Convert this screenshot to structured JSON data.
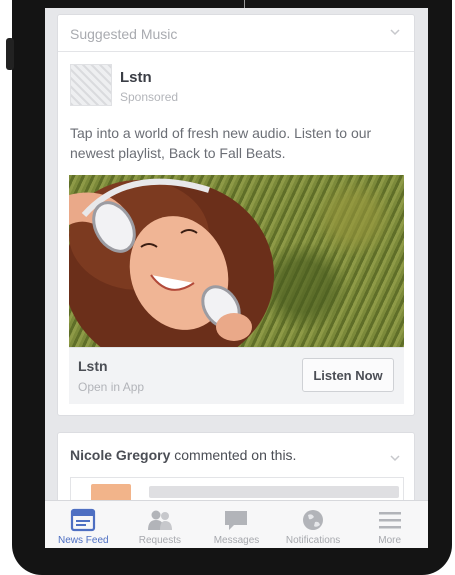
{
  "ad": {
    "header_label": "Suggested Music",
    "page_name": "Lstn",
    "sponsored_label": "Sponsored",
    "post_text": "Tap into a world of fresh new audio. Listen to our newest playlist, Back to Fall Beats.",
    "cta_title": "Lstn",
    "cta_subtitle": "Open in App",
    "cta_button": "Listen Now"
  },
  "comment_story": {
    "actor": "Nicole Gregory",
    "action": "commented on this."
  },
  "tab_bar": {
    "active_color": "#4e6fc2",
    "inactive_color": "#a7a9ae",
    "tabs": [
      {
        "label": "News Feed",
        "icon": "news-feed-icon"
      },
      {
        "label": "Requests",
        "icon": "friend-requests-icon"
      },
      {
        "label": "Messages",
        "icon": "messages-icon"
      },
      {
        "label": "Notifications",
        "icon": "globe-icon"
      },
      {
        "label": "More",
        "icon": "menu-icon"
      }
    ]
  }
}
